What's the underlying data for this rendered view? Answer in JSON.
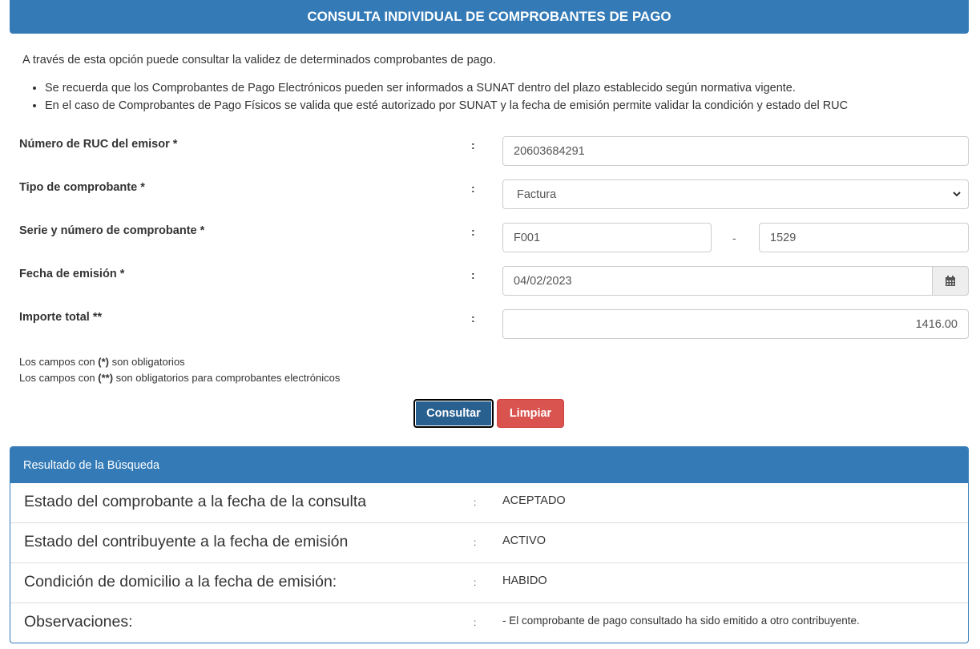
{
  "header": {
    "title": "CONSULTA INDIVIDUAL DE COMPROBANTES DE PAGO"
  },
  "intro": {
    "text": "A través de esta opción puede consultar la validez de determinados comprobantes de pago.",
    "bullets": [
      "Se recuerda que los Comprobantes de Pago Electrónicos pueden ser informados a SUNAT dentro del plazo establecido según normativa vigente.",
      "En el caso de Comprobantes de Pago Físicos se valida que esté autorizado por SUNAT y la fecha de emisión permite validar la condición y estado del RUC"
    ]
  },
  "form": {
    "colon": ":",
    "ruc": {
      "label": "Número de RUC del emisor *",
      "value": "20603684291"
    },
    "tipo": {
      "label": "Tipo de comprobante *",
      "value": "Factura"
    },
    "serie": {
      "label": "Serie y número de comprobante *",
      "serie_value": "F001",
      "separator": "-",
      "numero_value": "1529"
    },
    "fecha": {
      "label": "Fecha de emisión *",
      "value": "04/02/2023",
      "icon": "calendar-icon"
    },
    "importe": {
      "label": "Importe total **",
      "value": "1416.00"
    }
  },
  "notes": {
    "line1_prefix": "Los campos con ",
    "line1_bold": "(*)",
    "line1_suffix": " son obligatorios",
    "line2_prefix": "Los campos con ",
    "line2_bold": "(**)",
    "line2_suffix": " son obligatorios para comprobantes electrónicos"
  },
  "buttons": {
    "consultar": "Consultar",
    "limpiar": "Limpiar"
  },
  "result": {
    "title": "Resultado de la Búsqueda",
    "colon": ":",
    "rows": [
      {
        "label": "Estado del comprobante a la fecha de la consulta",
        "value": "ACEPTADO"
      },
      {
        "label": "Estado del contribuyente a la fecha de emisión",
        "value": "ACTIVO"
      },
      {
        "label": "Condición de domicilio a la fecha de emisión:",
        "value": "HABIDO"
      },
      {
        "label": "Observaciones:",
        "value": "- El comprobante de pago consultado ha sido emitido a otro contribuyente."
      }
    ]
  },
  "colors": {
    "primary": "#337ab7",
    "primary_dark": "#286090",
    "danger": "#d9534f"
  }
}
